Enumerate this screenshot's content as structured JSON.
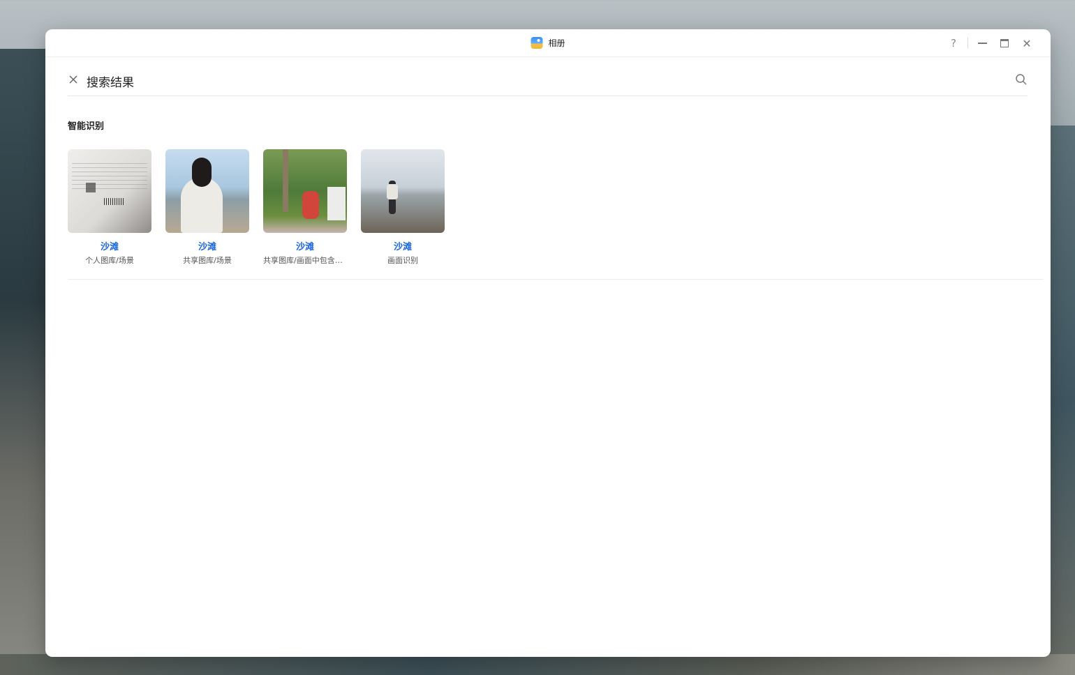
{
  "window": {
    "title": "相册",
    "controls": {
      "help": "?",
      "minimize": "minimize",
      "maximize": "maximize",
      "close": "close"
    }
  },
  "search": {
    "title": "搜索结果",
    "close_icon": "close-icon",
    "search_icon": "search-icon"
  },
  "section": {
    "title": "智能识别"
  },
  "results": [
    {
      "label": "沙滩",
      "sub": "个人图库/场景",
      "thumb": "document-photo"
    },
    {
      "label": "沙滩",
      "sub": "共享图库/场景",
      "thumb": "woman-beach-photo"
    },
    {
      "label": "沙滩",
      "sub": "共享图库/画面中包含沙滩",
      "thumb": "garden-photo"
    },
    {
      "label": "沙滩",
      "sub": "画面识别",
      "thumb": "beach-person-photo"
    }
  ],
  "colors": {
    "accent": "#1a66e6",
    "text": "#222222",
    "subtext": "#555555"
  }
}
